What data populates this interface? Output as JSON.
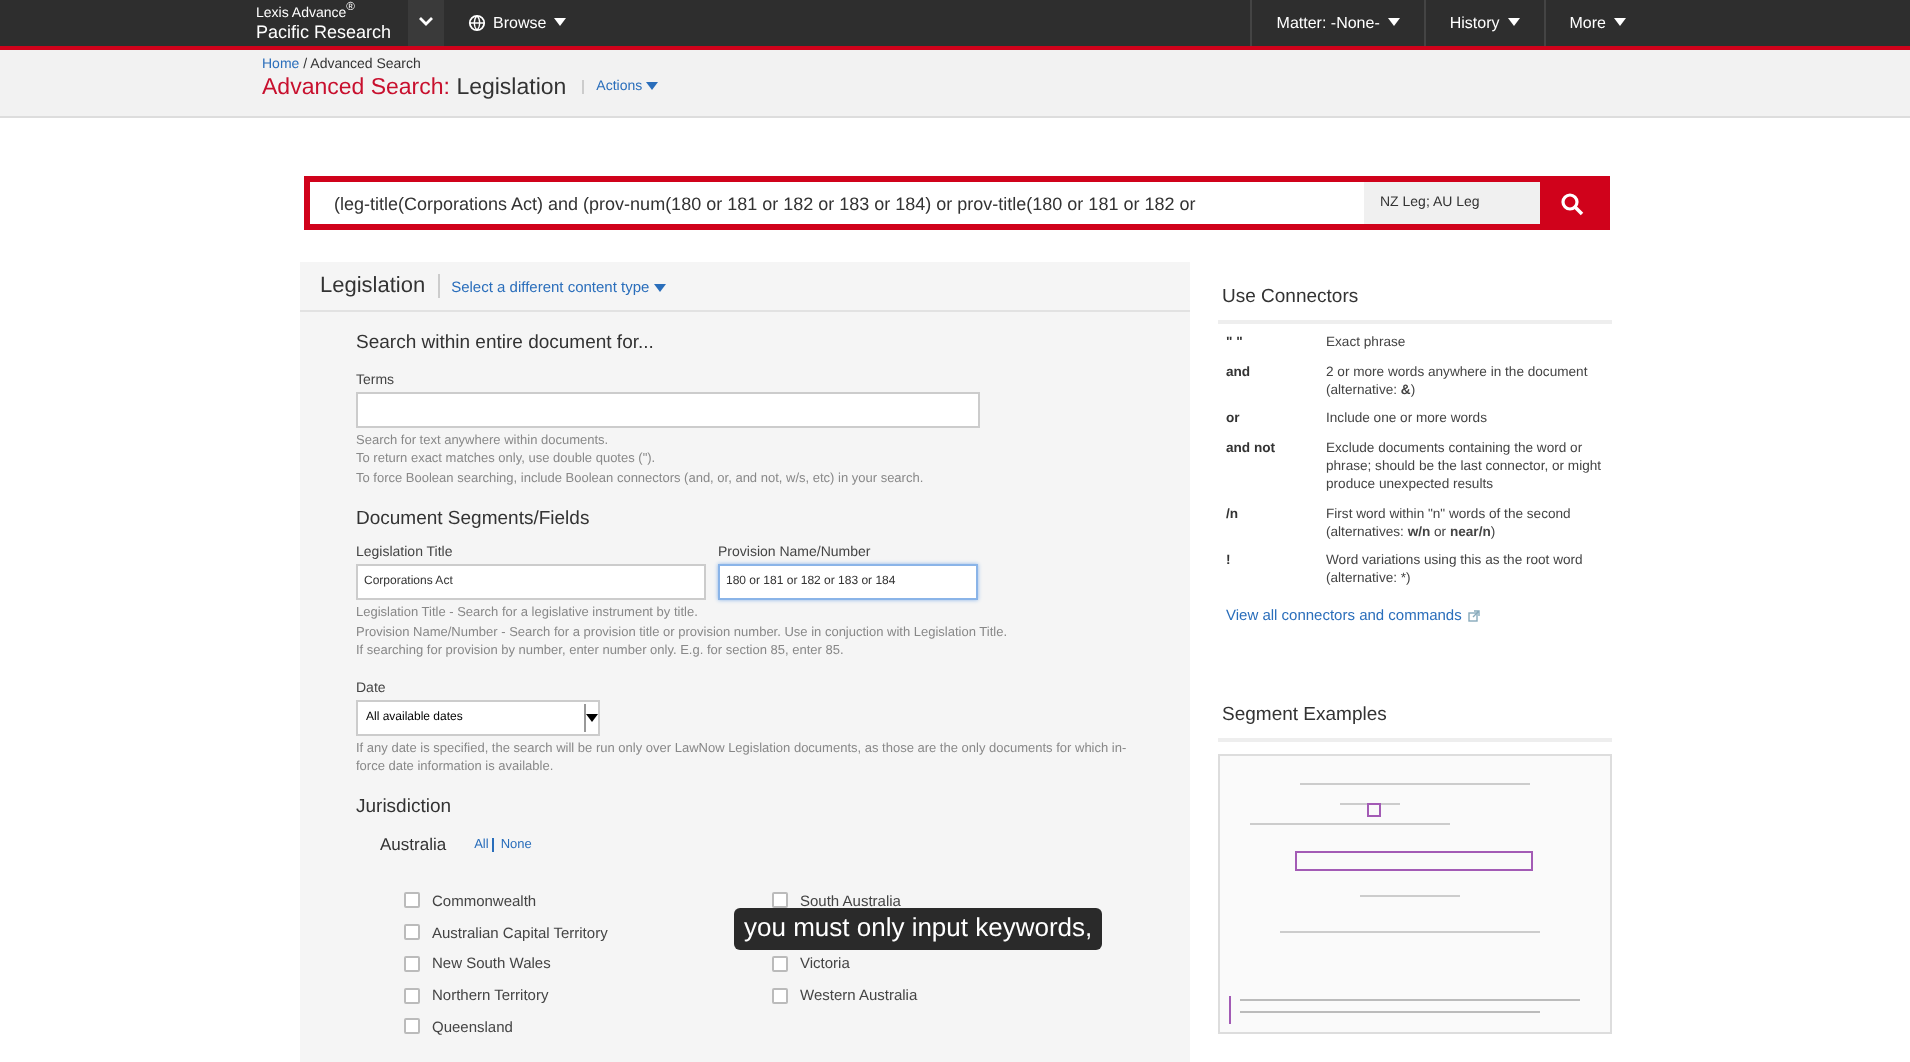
{
  "topbar": {
    "brand_line1": "Lexis Advance",
    "brand_mark": "®",
    "brand_line2": "Pacific Research",
    "browse_menu": "Browse",
    "menus": [
      "Matter: -None-",
      "History",
      "More"
    ]
  },
  "breadcrumb": {
    "link": "Home",
    "rest": "/ Advanced Search"
  },
  "page_title": {
    "accent": "Advanced Search:",
    "rest": "Legislation",
    "actions": "Actions"
  },
  "search": {
    "value": "(leg-title(Corporations Act) and (prov-num(180 or 181 or 182 or 183 or 184) or prov-title(180 or 181 or 182 or",
    "scope": "NZ Leg; AU Leg"
  },
  "form": {
    "title": "Legislation",
    "switch_link": "Select a different content type",
    "section_heading": "Search within entire document for...",
    "terms_label": "Terms",
    "terms_help": [
      "Search for text anywhere within documents.",
      "To return exact matches only, use double quotes (\").",
      "To force Boolean searching, include Boolean connectors (and, or, and not, w/s, etc) in your search."
    ],
    "segments_heading": "Document Segments/Fields",
    "fields": [
      {
        "label": "Legislation Title",
        "value": "Corporations Act",
        "focused": false
      },
      {
        "label": "Provision Name/Number",
        "value": "180 or 181 or 182 or 183 or 184",
        "focused": true
      }
    ],
    "fields_help": [
      "Legislation Title - Search for a legislative instrument by title.",
      "Provision Name/Number - Search for a provision title or provision number. Use in conjuction with Legislation Title.",
      "If searching for provision by number, enter number only. E.g. for section 85, enter 85."
    ],
    "date_label": "Date",
    "date_value": "All available dates",
    "date_help": "If any date is specified, the search will be run only over LawNow Legislation documents, as those are the only documents for which in-force date information is available.",
    "jurisdiction_heading": "Jurisdiction",
    "country": "Australia",
    "all_link": "All",
    "none_link": "None",
    "jurisdictions": [
      {
        "label": "Commonwealth",
        "checked": false
      },
      {
        "label": "Australian Capital Territory",
        "checked": false
      },
      {
        "label": "New South Wales",
        "checked": false
      },
      {
        "label": "Northern Territory",
        "checked": false
      },
      {
        "label": "Queensland",
        "checked": false
      },
      {
        "label": "South Australia",
        "checked": false
      },
      {
        "label": "Victoria",
        "checked": false
      },
      {
        "label": "Western Australia",
        "checked": false
      }
    ]
  },
  "connectors": {
    "title": "Use Connectors",
    "rows": [
      {
        "term": "\" \"",
        "meaning": "Exact phrase"
      },
      {
        "term": "and",
        "meaning": "2 or more words anywhere in the document (alternative: **&**)"
      },
      {
        "term": "or",
        "meaning": "Include one or more words"
      },
      {
        "term": "and not",
        "meaning": "Exclude documents containing the word or phrase; should be the last connector, or might produce unexpected results"
      },
      {
        "term": "/n",
        "meaning": "First word within \"n\" words of the second (alternatives: **w/n** or **near/n**)"
      },
      {
        "term": "!",
        "meaning": "Word variations using this as the root word (alternative: *)"
      }
    ],
    "link": "View all connectors and commands"
  },
  "segment_examples": {
    "title": "Segment Examples"
  },
  "caption": "you must only input keywords,"
}
